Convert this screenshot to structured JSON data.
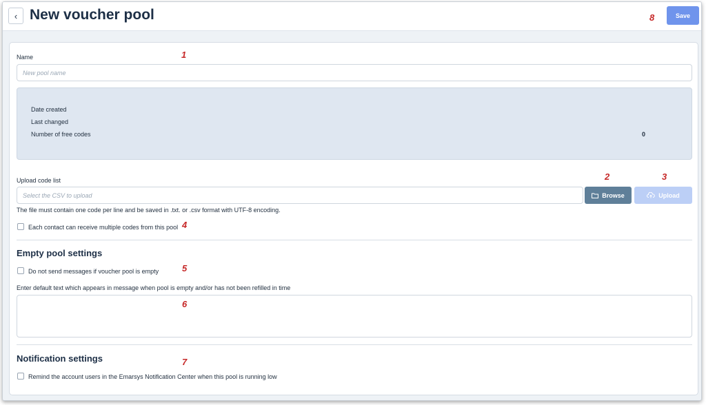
{
  "header": {
    "title": "New voucher pool",
    "save_label": "Save"
  },
  "markers": [
    "1",
    "2",
    "3",
    "4",
    "5",
    "6",
    "7",
    "8"
  ],
  "name_field": {
    "label": "Name",
    "placeholder": "New pool name"
  },
  "info": {
    "date_created_label": "Date created",
    "last_changed_label": "Last changed",
    "free_codes_label": "Number of free codes",
    "free_codes_value": "0"
  },
  "upload": {
    "label": "Upload code list",
    "placeholder": "Select the CSV to upload",
    "browse_label": "Browse",
    "upload_label": "Upload",
    "hint": "The file must contain one code per line and be saved in .txt. or .csv format with UTF-8 encoding."
  },
  "multiple_codes_label": "Each contact can receive multiple codes from this pool",
  "empty_pool": {
    "title": "Empty pool settings",
    "dont_send_label": "Do not send messages if voucher pool is empty",
    "default_text_label": "Enter default text which appears in message when pool is empty and/or has not been refilled in time"
  },
  "notification": {
    "title": "Notification settings",
    "remind_label": "Remind the account users in the Emarsys Notification Center when this pool is running low"
  },
  "icons": {
    "back": "chevron-left-icon",
    "browse": "folder-icon",
    "upload": "cloud-upload-icon"
  },
  "colors": {
    "save_button": "#6f94ec",
    "browse_button": "#5f7f99",
    "upload_button_disabled": "#bccff6",
    "info_box": "#dfe7f1",
    "marker": "#c62828"
  }
}
